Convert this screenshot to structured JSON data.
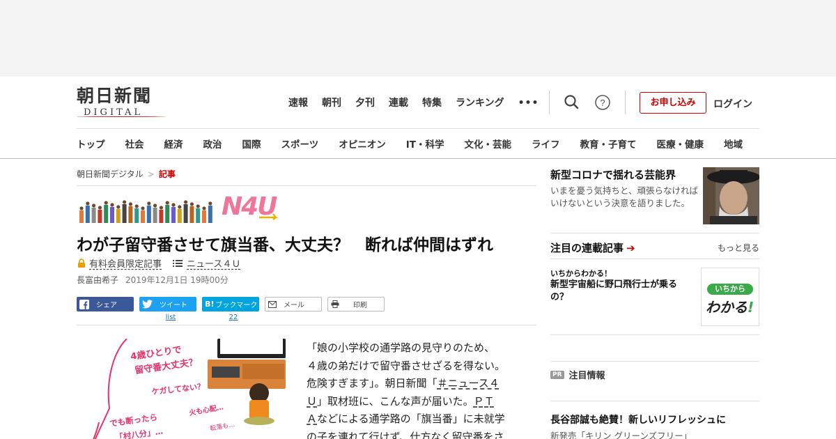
{
  "header": {
    "logo_main": "朝日新聞",
    "logo_sub": "DIGITAL",
    "top_nav": [
      "速報",
      "朝刊",
      "夕刊",
      "連載",
      "特集",
      "ランキング"
    ],
    "more_dots": "•••",
    "signup_label": "お申し込み",
    "login_label": "ログイン",
    "help_glyph": "?"
  },
  "section_nav": [
    "トップ",
    "社会",
    "経済",
    "政治",
    "国際",
    "スポーツ",
    "オピニオン",
    "IT・科学",
    "文化・芸能",
    "ライフ",
    "教育・子育て",
    "医療・健康",
    "地域"
  ],
  "breadcrumb": {
    "home": "朝日新聞デジタル",
    "sep": ">",
    "current": "記事"
  },
  "banner": {
    "logo_text": "N4U"
  },
  "article": {
    "headline": "わが子留守番させて旗当番、大丈夫？　断れば仲間はずれ",
    "members_only": "有料会員限定記事",
    "series_link": "ニュース４Ｕ",
    "author": "長富由希子",
    "date": "2019年12月1日 19時00分",
    "share": {
      "facebook": "シェア",
      "twitter": "ツイート",
      "twitter_count": "list",
      "hatena": "ブックマーク",
      "hatena_count": "22",
      "mail": "メール",
      "print": "印刷"
    },
    "illustration": {
      "line1": "4歳ひとりで",
      "line2": "留守番大丈夫？",
      "line3": "ケガしてない？",
      "line4": "火も心配…",
      "line5": "転落も…",
      "line6": "でも断ったら",
      "line7": "「村八分」…"
    },
    "body_lines": [
      "「娘の小学校の通学路の見守りのため、",
      "４歳の弟だけで留守番させざるを得ない。",
      "危険すぎます」。朝日新聞「＃ニュース４",
      "Ｕ」取材班に、こんな声が届いた。ＰＴ",
      "Ａなどによる通学路の「旗当番」に未就学",
      "の子を連れて行けず、仕方なく留守番をさ"
    ],
    "body_seg": {
      "l3a": "危険すぎます」。朝日新聞「",
      "l3b": "＃ニュース４",
      "l4a": "Ｕ",
      "l4b": "」取材班に、こんな声が届いた。",
      "l4c": "ＰＴ",
      "l5a": "Ａ",
      "l5b": "などによる通学路の「旗当番」に未就学"
    }
  },
  "sidebar": {
    "promo": {
      "title": "新型コロナで揺れる芸能界",
      "desc": "いまを憂う気持ちと、頑張らなければいけないという決意を語りました。"
    },
    "series": {
      "heading": "注目の連載記事",
      "see_more": "もっと見る",
      "kicker": "いちからわかる！",
      "title": "新型宇宙船に野口飛行士が乗るの？",
      "badge_top": "いちから",
      "badge_bottom": "わかる",
      "badge_mark": "!"
    },
    "pr": {
      "badge": "PR",
      "heading": "注目情報",
      "title": "長谷部誠も絶賛！新しいリフレッシュに",
      "sub": "新発売「キリン グリーンズフリー」"
    }
  },
  "colors": {
    "accent": "#cc0000",
    "facebook": "#3b5998",
    "twitter": "#1da1f2",
    "hatena": "#00a4de",
    "n4u": "#ee7799"
  }
}
